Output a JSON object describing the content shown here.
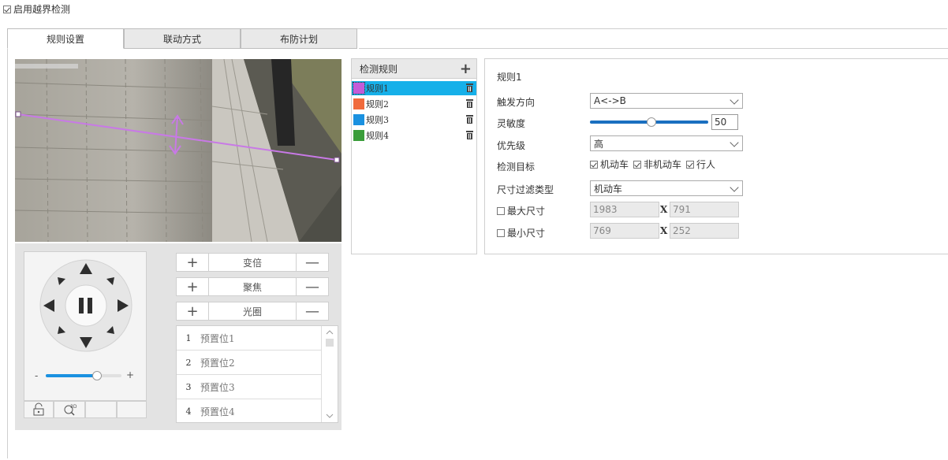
{
  "header": {
    "enable_label": "启用越界检测",
    "enable_checked": true
  },
  "tabs": [
    {
      "label": "规则设置",
      "active": true
    },
    {
      "label": "联动方式",
      "active": false
    },
    {
      "label": "布防计划",
      "active": false
    }
  ],
  "ptz": {
    "zoom_label": "变倍",
    "focus_label": "聚焦",
    "iris_label": "光圈",
    "plus": "+",
    "minus": "—",
    "speed_min": "-",
    "speed_max": "+",
    "speed_level": 0.68,
    "presets": [
      {
        "num": "1",
        "name": "预置位1"
      },
      {
        "num": "2",
        "name": "预置位2"
      },
      {
        "num": "3",
        "name": "预置位3"
      },
      {
        "num": "4",
        "name": "预置位4"
      }
    ]
  },
  "rules": {
    "header": "检测规则",
    "add_icon": "+",
    "items": [
      {
        "name": "规则1",
        "color": "#c45bd8",
        "selected": true
      },
      {
        "name": "规则2",
        "color": "#f06a3c",
        "selected": false
      },
      {
        "name": "规则3",
        "color": "#1a91e0",
        "selected": false
      },
      {
        "name": "规则4",
        "color": "#3a9d3a",
        "selected": false
      }
    ]
  },
  "settings": {
    "title": "规则1",
    "direction_label": "触发方向",
    "direction_value": "A<->B",
    "sensitivity_label": "灵敏度",
    "sensitivity_value": "50",
    "priority_label": "优先级",
    "priority_value": "高",
    "target_label": "检测目标",
    "targets": [
      {
        "label": "机动车",
        "checked": true
      },
      {
        "label": "非机动车",
        "checked": true
      },
      {
        "label": "行人",
        "checked": true
      }
    ],
    "filter_label": "尺寸过滤类型",
    "filter_value": "机动车",
    "max_label": "最大尺寸",
    "max_w": "1983",
    "max_h": "791",
    "min_label": "最小尺寸",
    "min_w": "769",
    "min_h": "252",
    "x_sep": "X"
  },
  "colors": {
    "accent": "#16b0e9",
    "line": "#c879e6"
  }
}
